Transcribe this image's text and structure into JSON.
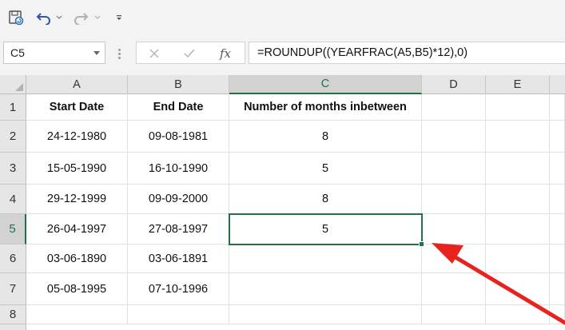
{
  "toolbar": {
    "icons": [
      "autosave-icon",
      "undo-icon",
      "undo-dropdown-icon",
      "redo-icon",
      "redo-dropdown-icon",
      "customize-toolbar-icon"
    ]
  },
  "formula_bar": {
    "name_box": "C5",
    "cancel_icon": "close-icon",
    "enter_icon": "check-icon",
    "fx_label": "fx",
    "formula": "=ROUNDUP((YEARFRAC(A5,B5)*12),0)"
  },
  "sheet": {
    "columns": [
      "A",
      "B",
      "C",
      "D",
      "E"
    ],
    "rows": [
      "1",
      "2",
      "3",
      "4",
      "5",
      "6",
      "7",
      "8"
    ],
    "active_cell": "C5",
    "headers": {
      "start_date": "Start Date",
      "end_date": "End Date",
      "months": "Number of months inbetween"
    },
    "data": [
      {
        "start": "24-12-1980",
        "end": "09-08-1981",
        "months": "8"
      },
      {
        "start": "15-05-1990",
        "end": "16-10-1990",
        "months": "5"
      },
      {
        "start": "29-12-1999",
        "end": "09-09-2000",
        "months": "8"
      },
      {
        "start": "26-04-1997",
        "end": "27-08-1997",
        "months": "5"
      },
      {
        "start": "03-06-1890",
        "end": "03-06-1891",
        "months": ""
      },
      {
        "start": "05-08-1995",
        "end": "07-10-1996",
        "months": ""
      }
    ]
  },
  "annotation": {
    "arrow_color": "#e8231e",
    "accent_color": "#217346"
  }
}
